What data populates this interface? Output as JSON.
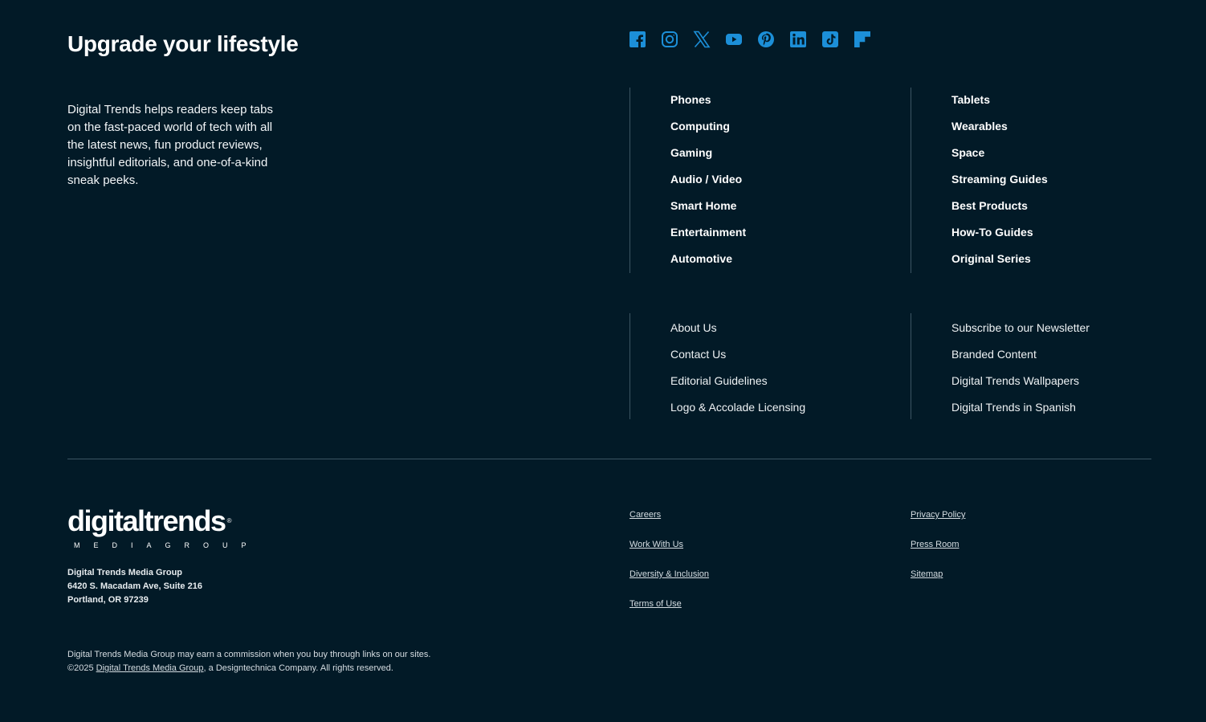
{
  "brand": {
    "headline": "Upgrade your lifestyle",
    "description": "Digital Trends helps readers keep tabs on the fast-paced world of tech with all the latest news, fun product reviews, insightful editorials, and one-of-a-kind sneak peeks.",
    "accent_color": "#1c8fd8",
    "background_color": "#021a27"
  },
  "social": {
    "icons": [
      "facebook-icon",
      "instagram-icon",
      "x-icon",
      "youtube-icon",
      "pinterest-icon",
      "linkedin-icon",
      "tiktok-icon",
      "flipboard-icon"
    ]
  },
  "categories": {
    "col1": [
      "Phones",
      "Computing",
      "Gaming",
      "Audio / Video",
      "Smart Home",
      "Entertainment",
      "Automotive"
    ],
    "col2": [
      "Tablets",
      "Wearables",
      "Space",
      "Streaming Guides",
      "Best Products",
      "How-To Guides",
      "Original Series"
    ]
  },
  "company_links": {
    "col1": [
      "About Us",
      "Contact Us",
      "Editorial Guidelines",
      "Logo & Accolade Licensing"
    ],
    "col2": [
      "Subscribe to our Newsletter",
      "Branded Content",
      "Digital Trends Wallpapers",
      "Digital Trends in Spanish"
    ]
  },
  "logo": {
    "wordmark": "digitaltrends",
    "registered": "®",
    "subtitle": "MEDIAGROUP"
  },
  "address": {
    "line1": "Digital Trends Media Group",
    "line2": "6420 S. Macadam Ave, Suite 216",
    "line3": "Portland, OR 97239"
  },
  "legal": {
    "commission": "Digital Trends Media Group may earn a commission when you buy through links on our sites.",
    "copyright_prefix": "©2025 ",
    "copyright_link": "Digital Trends Media Group",
    "copyright_suffix": ", a Designtechnica Company. All rights reserved."
  },
  "footer_links": {
    "col1": [
      "Careers",
      "Work With Us",
      "Diversity & Inclusion",
      "Terms of Use"
    ],
    "col2": [
      "Privacy Policy",
      "Press Room",
      "Sitemap"
    ]
  }
}
